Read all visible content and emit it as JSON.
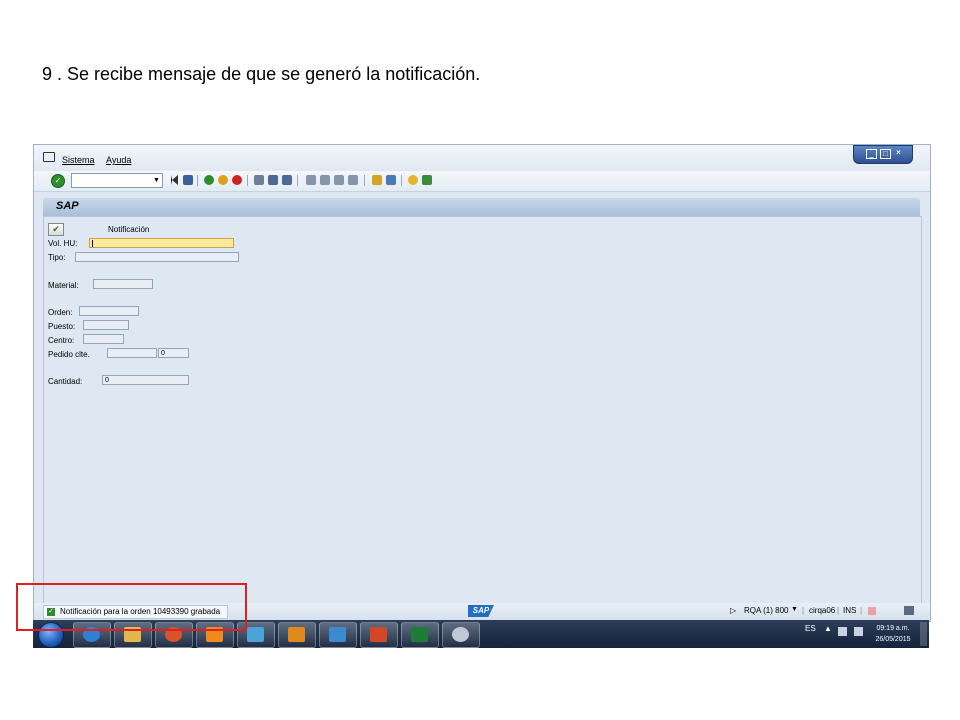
{
  "slide": {
    "title": "9 . Se recibe mensaje de que se generó la notificación."
  },
  "menu": {
    "items": [
      "Sistema",
      "Ayuda"
    ]
  },
  "header": {
    "title": "SAP"
  },
  "form": {
    "notif_label": "Notificación",
    "vol_hu_label": "Vol. HU:",
    "tipo_label": "Tipo:",
    "material_label": "Material:",
    "orden_label": "Orden:",
    "puesto_label": "Puesto:",
    "centro_label": "Centro:",
    "pedido_label": "Pedido clte.",
    "pedido_pos_value": "0",
    "cantidad_label": "Cantidad:",
    "cantidad_value": "0"
  },
  "status": {
    "message": "Notificación para la orden 10493390 grabada",
    "logo": "SAP",
    "system": "RQA (1) 800",
    "server": "cirqa06",
    "mode": "INS"
  },
  "taskbar": {
    "language": "ES",
    "time": "09:19 a.m.",
    "date": "26/05/2015"
  },
  "colors": {
    "highlight": "#e02020",
    "field_active": "#fde99c",
    "accent": "#1f6fc4"
  }
}
